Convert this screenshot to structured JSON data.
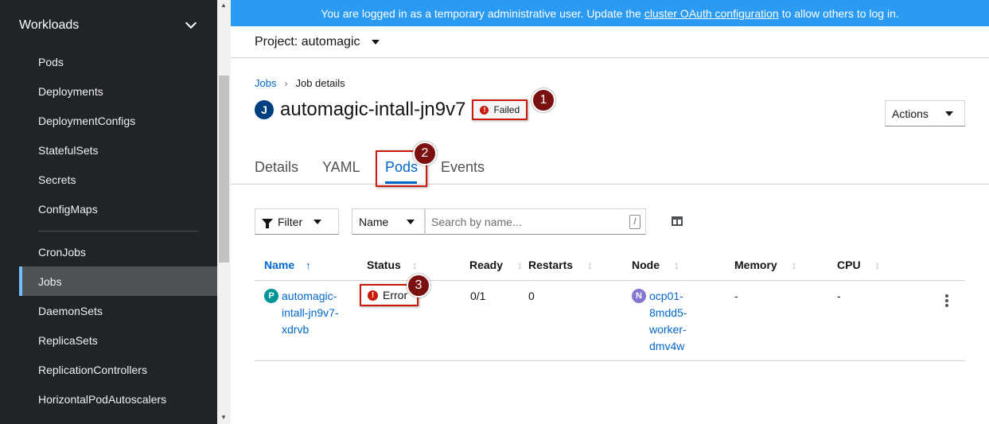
{
  "sidebar": {
    "section_label": "Workloads",
    "items": [
      {
        "label": "Pods",
        "active": false
      },
      {
        "label": "Deployments",
        "active": false
      },
      {
        "label": "DeploymentConfigs",
        "active": false
      },
      {
        "label": "StatefulSets",
        "active": false
      },
      {
        "label": "Secrets",
        "active": false
      },
      {
        "label": "ConfigMaps",
        "active": false
      },
      {
        "label": "CronJobs",
        "active": false
      },
      {
        "label": "Jobs",
        "active": true
      },
      {
        "label": "DaemonSets",
        "active": false
      },
      {
        "label": "ReplicaSets",
        "active": false
      },
      {
        "label": "ReplicationControllers",
        "active": false
      },
      {
        "label": "HorizontalPodAutoscalers",
        "active": false
      }
    ]
  },
  "banner": {
    "text_before": "You are logged in as a temporary administrative user. Update the",
    "link": "cluster OAuth configuration",
    "text_after": "to allow others to log in."
  },
  "project": {
    "label": "Project: automagic"
  },
  "breadcrumb": {
    "parent": "Jobs",
    "current": "Job details"
  },
  "job": {
    "badge": "J",
    "name": "automagic-intall-jn9v7",
    "status": "Failed"
  },
  "actions": {
    "label": "Actions"
  },
  "tabs": [
    {
      "label": "Details",
      "active": false
    },
    {
      "label": "YAML",
      "active": false
    },
    {
      "label": "Pods",
      "active": true
    },
    {
      "label": "Events",
      "active": false
    }
  ],
  "toolbar": {
    "filter_label": "Filter",
    "name_select": "Name",
    "search_placeholder": "Search by name...",
    "shortcut_key": "/"
  },
  "table": {
    "columns": [
      "Name",
      "Status",
      "Ready",
      "Restarts",
      "Node",
      "Memory",
      "CPU"
    ],
    "rows": [
      {
        "pod_badge": "P",
        "name_lines": [
          "automagic-",
          "intall-jn9v7-",
          "xdrvb"
        ],
        "status": "Error",
        "ready": "0/1",
        "restarts": "0",
        "node_badge": "N",
        "node_lines": [
          "ocp01-",
          "8mdd5-",
          "worker-",
          "dmv4w"
        ],
        "memory": "-",
        "cpu": "-"
      }
    ]
  },
  "markers": [
    "1",
    "2",
    "3"
  ],
  "colors": {
    "sidebar_bg": "#212427",
    "banner_bg": "#2b9af3",
    "link": "#0066cc",
    "danger": "#c9190b",
    "marker": "#7a1010",
    "pod_badge": "#009596",
    "node_badge": "#8476d1"
  }
}
